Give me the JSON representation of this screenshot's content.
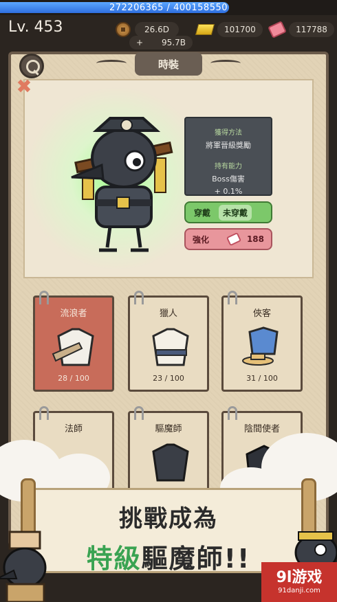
{
  "top": {
    "xp_text": "272206365 / 400158550",
    "xp_progress": 0.68,
    "level": "Lv. 453",
    "coins": "26.6D",
    "gold": "101700",
    "tickets": "117788",
    "sub_plus": "+",
    "sub_value": "95.7B"
  },
  "panel": {
    "title": "時裝",
    "obtain_label": "獲得方法",
    "obtain_value": "將軍晉級獎勵",
    "ability_label": "持有能力",
    "ability_value": "Boss傷害",
    "ability_bonus": "+ 0.1%",
    "wear_label": "穿戴",
    "unwear_label": "未穿戴",
    "enhance_label": "強化",
    "enhance_cost": "188"
  },
  "cards": [
    {
      "name": "流浪者",
      "count": "28 / 100"
    },
    {
      "name": "獵人",
      "count": "23 / 100"
    },
    {
      "name": "俠客",
      "count": "31 / 100"
    },
    {
      "name": "法師",
      "count": ""
    },
    {
      "name": "驅魔師",
      "count": ""
    },
    {
      "name": "陰間使者",
      "count": ""
    }
  ],
  "banner": {
    "line1": "挑戰成為",
    "line2_green": "特級",
    "line2_dark": "驅魔師!!"
  },
  "watermark": {
    "logo": "9l游戏",
    "url": "91danji.com"
  },
  "colors": {
    "accent_green": "#7cc86a",
    "accent_red": "#e8969c",
    "board": "#e2d3b6"
  }
}
